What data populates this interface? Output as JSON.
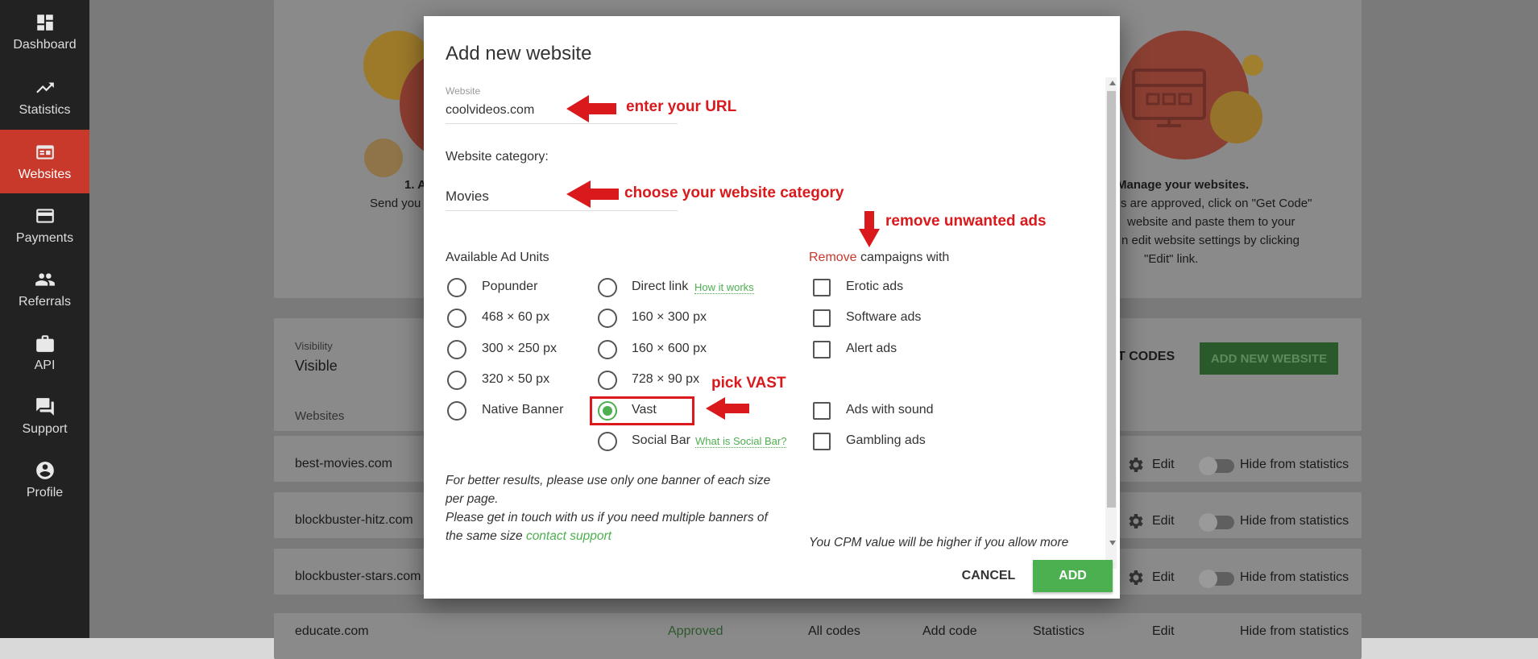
{
  "sidebar": {
    "items": [
      {
        "label": "Dashboard",
        "icon": "dashboard-icon",
        "active": false
      },
      {
        "label": "Statistics",
        "icon": "trending-icon",
        "active": false
      },
      {
        "label": "Websites",
        "icon": "websites-icon",
        "active": true
      },
      {
        "label": "Payments",
        "icon": "card-icon",
        "active": false
      },
      {
        "label": "Referrals",
        "icon": "people-icon",
        "active": false
      },
      {
        "label": "API",
        "icon": "briefcase-icon",
        "active": false
      },
      {
        "label": "Support",
        "icon": "chat-icon",
        "active": false
      },
      {
        "label": "Profile",
        "icon": "person-icon",
        "active": false
      }
    ]
  },
  "background": {
    "steps": {
      "step1_title": "1. A",
      "step1_text": "Send you",
      "step3_title": "Manage your websites.",
      "step3_line1": "s are approved, click on \"Get Code\"",
      "step3_line2": "website and paste them to your",
      "step3_line3": "n edit website settings by clicking",
      "step3_line4": "\"Edit\" link."
    },
    "visibility_label": "Visibility",
    "visibility_value": "Visible",
    "get_codes_partial": "T CODES",
    "add_new_website_button": "ADD NEW WEBSITE",
    "websites_header": "Websites",
    "rows": [
      {
        "domain": "best-movies.com",
        "edit": "Edit",
        "hide": "Hide from statistics"
      },
      {
        "domain": "blockbuster-hitz.com",
        "edit": "Edit",
        "hide": "Hide from statistics"
      },
      {
        "domain": "blockbuster-stars.com",
        "edit": "Edit",
        "hide": "Hide from statistics"
      },
      {
        "domain": "educate.com",
        "status": "Approved",
        "all_codes": "All codes",
        "add_code": "Add code",
        "statistics": "Statistics",
        "edit": "Edit",
        "hide": "Hide from statistics"
      }
    ]
  },
  "modal": {
    "title": "Add new website",
    "website_field_label": "Website",
    "website_field_value": "coolvideos.com",
    "category_label": "Website category:",
    "category_value": "Movies",
    "ad_units_label": "Available Ad Units",
    "ad_units_col1": [
      "Popunder",
      "468 × 60 px",
      "300 × 250 px",
      "320 × 50 px",
      "Native Banner"
    ],
    "ad_units_col2": [
      "Direct link",
      "160 × 300 px",
      "160 × 600 px",
      "728 × 90 px",
      "Vast",
      "Social Bar"
    ],
    "selected_unit": "Vast",
    "how_it_works": "How it works",
    "what_is_social_bar": "What is Social Bar?",
    "remove_word": "Remove",
    "remove_rest": " campaigns with",
    "remove_options": [
      "Erotic ads",
      "Software ads",
      "Alert ads",
      "Ads with sound",
      "Gambling ads"
    ],
    "note_line1": "For better results, please use only one banner of each size per page.",
    "note_line2": "Please get in touch with us if you need multiple banners of the same size ",
    "note_link": "contact support",
    "cpm_note": "You CPM value will be higher if you allow more",
    "cancel_label": "CANCEL",
    "add_label": "ADD"
  },
  "annotations": {
    "url": "enter your URL",
    "category": "choose your website category",
    "remove": "remove unwanted ads",
    "vast": "pick VAST"
  },
  "colors": {
    "accent_green": "#4caf50",
    "sidebar_active": "#c8382b",
    "annotation_red": "#d9191c",
    "remove_word": "#c8382b"
  }
}
